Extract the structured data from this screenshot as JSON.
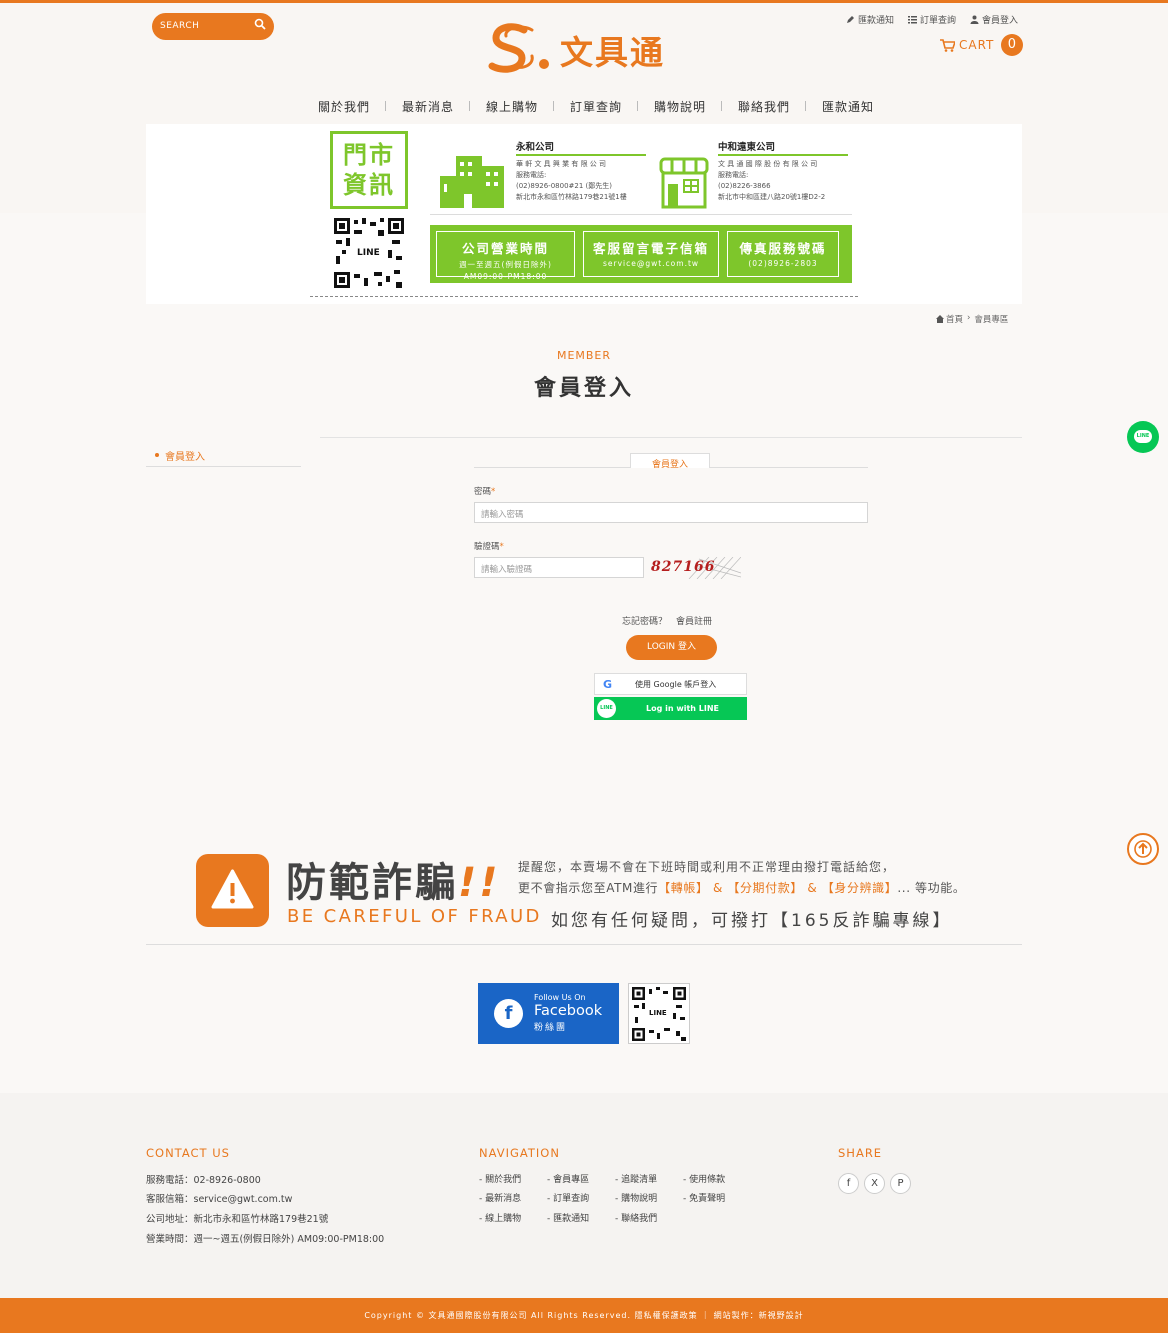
{
  "header": {
    "search_placeholder": "SEARCH",
    "logo_text": "文具通",
    "top_links": [
      "匯款通知",
      "訂單查詢",
      "會員登入"
    ],
    "cart_label": "CART",
    "cart_count": "0",
    "nav": [
      "關於我們",
      "最新消息",
      "線上購物",
      "訂單查詢",
      "購物說明",
      "聯絡我們",
      "匯款通知"
    ]
  },
  "banner": {
    "store_title_1": "門市",
    "store_title_2": "資訊",
    "qr_label": "LINE",
    "company1": {
      "name": "永和公司",
      "lines": [
        "華 軒 文 具 興 業 有 限 公 司",
        "服務電話:",
        "(02)8926-0800#21 (鄭先生)",
        "新北市永和區竹林路179巷21號1樓"
      ]
    },
    "company2": {
      "name": "中和遠東公司",
      "lines": [
        "文 具 通 國 際 股 份 有 限 公 司",
        "服務電話:",
        "(02)8226-3866",
        "新北市中和區建八路20號1樓D2-2"
      ]
    },
    "boxes": [
      {
        "title": "公司營業時間",
        "sub1": "週一至週五(例假日除外)",
        "sub2": "AM09:00-PM18:00"
      },
      {
        "title": "客服留言電子信箱",
        "sub1": "service@gwt.com.tw",
        "sub2": ""
      },
      {
        "title": "傳真服務號碼",
        "sub1": "(02)8926-2803",
        "sub2": ""
      }
    ]
  },
  "breadcrumb": {
    "home": "首頁",
    "separator": "›",
    "current": "會員專區"
  },
  "page": {
    "title_en": "MEMBER",
    "title_zh": "會員登入"
  },
  "sidebar": {
    "items": [
      {
        "label": "會員登入"
      }
    ]
  },
  "login_form": {
    "tab_label": "會員登入",
    "password_label": "密碼",
    "password_placeholder": "請輸入密碼",
    "captcha_label": "驗證碼",
    "captcha_placeholder": "請輸入驗證碼",
    "required_mark": "*",
    "captcha_text": "827166",
    "forgot_label": "忘記密碼？",
    "register_label": "會員註冊",
    "login_button": "LOGIN 登入",
    "google_button": "使用 Google 帳戶登入",
    "line_button": "Log in with LINE",
    "line_icon_text": "LINE"
  },
  "fraud": {
    "title": "防範詐騙",
    "exclaim": "!!",
    "subtitle_en": "BE CAREFUL OF FRAUD",
    "line1": "提醒您，本賣場不會在下班時間或利用不正常理由撥打電話給您，",
    "line2_prefix": "更不會指示您至ATM進行",
    "line2_highlight": "【轉帳】 & 【分期付款】 & 【身分辨識】",
    "line2_suffix": "... 等功能。",
    "line3": "如您有任何疑問，可撥打【165反詐騙專線】"
  },
  "social": {
    "fb_small": "Follow Us On",
    "fb_big": "Facebook",
    "fb_sub": "粉絲團",
    "qr_label": "LINE"
  },
  "footer": {
    "contact_title": "CONTACT US",
    "contact_lines": [
      "服務電話：02-8926-0800",
      "客服信箱：service@gwt.com.tw",
      "公司地址：新北市永和區竹林路179巷21號",
      "營業時間：週一~週五(例假日除外) AM09:00-PM18:00"
    ],
    "nav_title": "NAVIGATION",
    "nav_cols": [
      [
        "- 關於我們",
        "- 最新消息",
        "- 線上購物"
      ],
      [
        "- 會員專區",
        "- 訂單查詢",
        "- 匯款通知"
      ],
      [
        "- 追蹤清單",
        "- 購物說明",
        "- 聯絡我們"
      ],
      [
        "- 使用條款",
        "- 免責聲明"
      ]
    ],
    "share_title": "SHARE",
    "share_icons": [
      "f",
      "X",
      "P"
    ],
    "copyright": "Copyright © 文具通國際股份有限公司 All Rights Reserved. 隱私權保護政策 ｜ 網站製作：新視野設計"
  },
  "colors": {
    "accent": "#e8781f",
    "green": "#7ec62b",
    "line_green": "#06c755",
    "facebook": "#1a65c6"
  }
}
